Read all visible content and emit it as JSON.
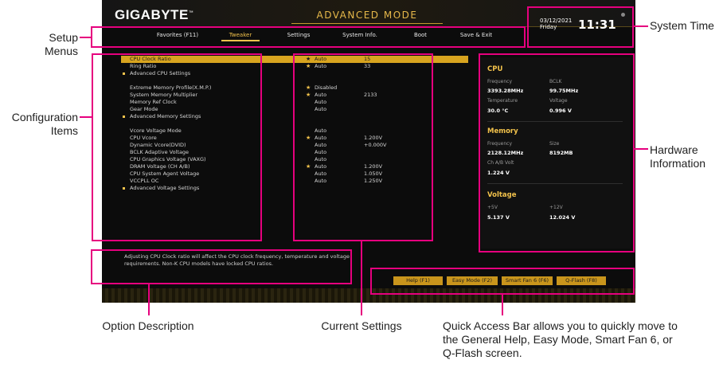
{
  "header": {
    "logo": "GIGABYTE",
    "logo_tm": "™",
    "mode": "ADVANCED MODE",
    "date": "03/12/2021",
    "day": "Friday",
    "time": "11:31"
  },
  "menus": [
    "Favorites (F11)",
    "Tweaker",
    "Settings",
    "System Info.",
    "Boot",
    "Save & Exit"
  ],
  "active_menu": "Tweaker",
  "config_items": [
    {
      "name": "CPU Clock Ratio",
      "star": true,
      "option": "Auto",
      "value": "15",
      "selected": true
    },
    {
      "name": "Ring Ratio",
      "star": true,
      "option": "Auto",
      "value": "33"
    },
    {
      "name": "Advanced CPU Settings",
      "bullet": true
    },
    {
      "name": "Extreme Memory Profile(X.M.P.)",
      "star": true,
      "option": "Disabled"
    },
    {
      "name": "System Memory Multiplier",
      "star": true,
      "option": "Auto",
      "value": "2133"
    },
    {
      "name": "Memory Ref Clock",
      "option": "Auto"
    },
    {
      "name": "Gear Mode",
      "option": "Auto"
    },
    {
      "name": "Advanced Memory Settings",
      "bullet": true
    },
    {
      "name": "Vcore Voltage Mode",
      "option": "Auto"
    },
    {
      "name": "CPU Vcore",
      "star": true,
      "option": "Auto",
      "value": "1.200V"
    },
    {
      "name": "Dynamic Vcore(DVID)",
      "option": "Auto",
      "value": "+0.000V"
    },
    {
      "name": "BCLK Adaptive Voltage",
      "option": "Auto"
    },
    {
      "name": "CPU Graphics Voltage (VAXG)",
      "option": "Auto"
    },
    {
      "name": "DRAM Voltage    (CH A/B)",
      "star": true,
      "option": "Auto",
      "value": "1.200V"
    },
    {
      "name": "CPU System Agent Voltage",
      "option": "Auto",
      "value": "1.050V"
    },
    {
      "name": "VCCPLL OC",
      "option": "Auto",
      "value": "1.250V"
    },
    {
      "name": "Advanced Voltage Settings",
      "bullet": true
    }
  ],
  "hardware": {
    "cpu": {
      "title": "CPU",
      "frequency_label": "Frequency",
      "frequency": "3393.28MHz",
      "bclk_label": "BCLK",
      "bclk": "99.75MHz",
      "temp_label": "Temperature",
      "temp": "30.0 °C",
      "voltage_label": "Voltage",
      "voltage": "0.996 V"
    },
    "memory": {
      "title": "Memory",
      "frequency_label": "Frequency",
      "frequency": "2128.12MHz",
      "size_label": "Size",
      "size": "8192MB",
      "volt_label": "Ch A/B Volt",
      "volt": "1.224 V"
    },
    "voltage": {
      "title": "Voltage",
      "p5_label": "+5V",
      "p5": "5.137 V",
      "p12_label": "+12V",
      "p12": "12.024 V"
    }
  },
  "description": "Adjusting CPU Clock ratio will affect the CPU clock frequency, temperature and voltage requirements. Non-K CPU models have locked CPU ratios.",
  "quick_access": [
    "Help (F1)",
    "Easy Mode (F2)",
    "Smart Fan 6 (F6)",
    "Q-Flash (F8)"
  ],
  "annotations": {
    "setup_menus": "Setup\nMenus",
    "configuration_items": "Configuration\nItems",
    "system_time": "System Time",
    "hardware_information": "Hardware\nInformation",
    "option_description": "Option Description",
    "current_settings": "Current Settings",
    "quick_access": "Quick Access Bar allows you to quickly move to\nthe General Help, Easy Mode, Smart Fan 6, or\nQ-Flash screen."
  },
  "colors": {
    "annotation": "#e6007e",
    "accent": "#f2c24b",
    "highlight": "#d8a41f"
  }
}
